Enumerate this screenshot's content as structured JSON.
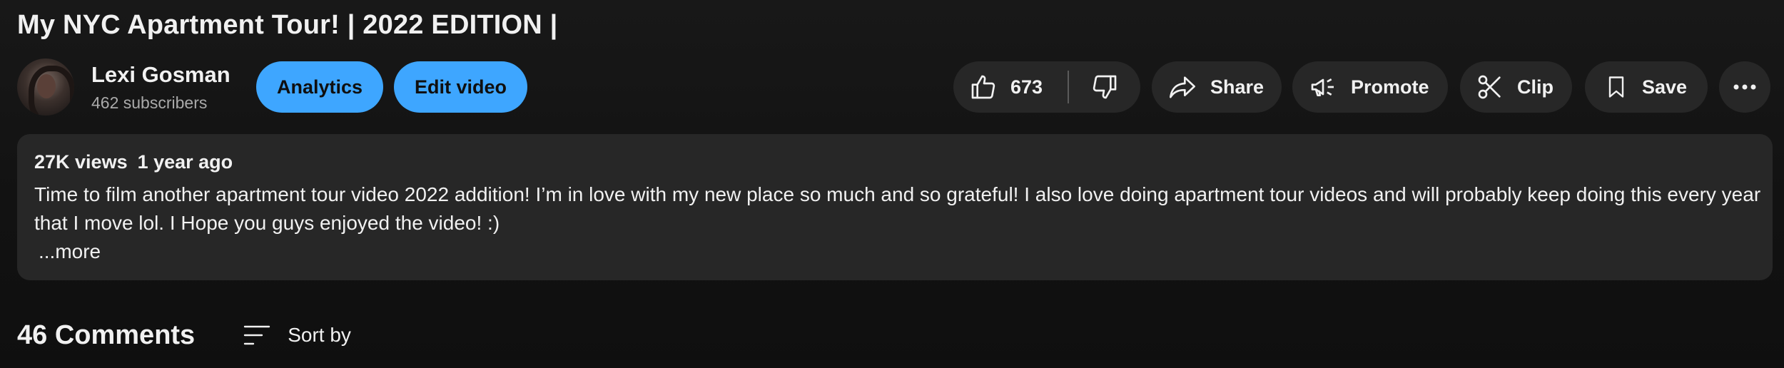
{
  "video": {
    "title": "My NYC Apartment Tour! | 2022 EDITION |"
  },
  "channel": {
    "name": "Lexi Gosman",
    "subscribers": "462 subscribers"
  },
  "owner_actions": {
    "analytics_label": "Analytics",
    "edit_label": "Edit video"
  },
  "actions": {
    "like_count": "673",
    "share_label": "Share",
    "promote_label": "Promote",
    "clip_label": "Clip",
    "save_label": "Save"
  },
  "description": {
    "views": "27K views",
    "age": "1 year ago",
    "text": "Time to film another apartment tour video 2022 addition! I’m in love with my  new place so much and so grateful! I also love doing apartment tour videos and will probably keep doing this every year that I move lol. I Hope you guys enjoyed the video! :)",
    "more_label": "...more"
  },
  "comments": {
    "count_label": "46 Comments",
    "sort_label": "Sort by"
  },
  "icons": {
    "like": "thumbs-up-icon",
    "dislike": "thumbs-down-icon",
    "share": "share-arrow-icon",
    "promote": "megaphone-icon",
    "clip": "scissors-icon",
    "save": "bookmark-icon",
    "more": "more-horizontal-icon",
    "sort": "sort-lines-icon"
  },
  "colors": {
    "background": "#0f0f0f",
    "pill_dark": "#272727",
    "accent_blue": "#3ea6ff",
    "secondary_text": "#aaaaaa"
  }
}
